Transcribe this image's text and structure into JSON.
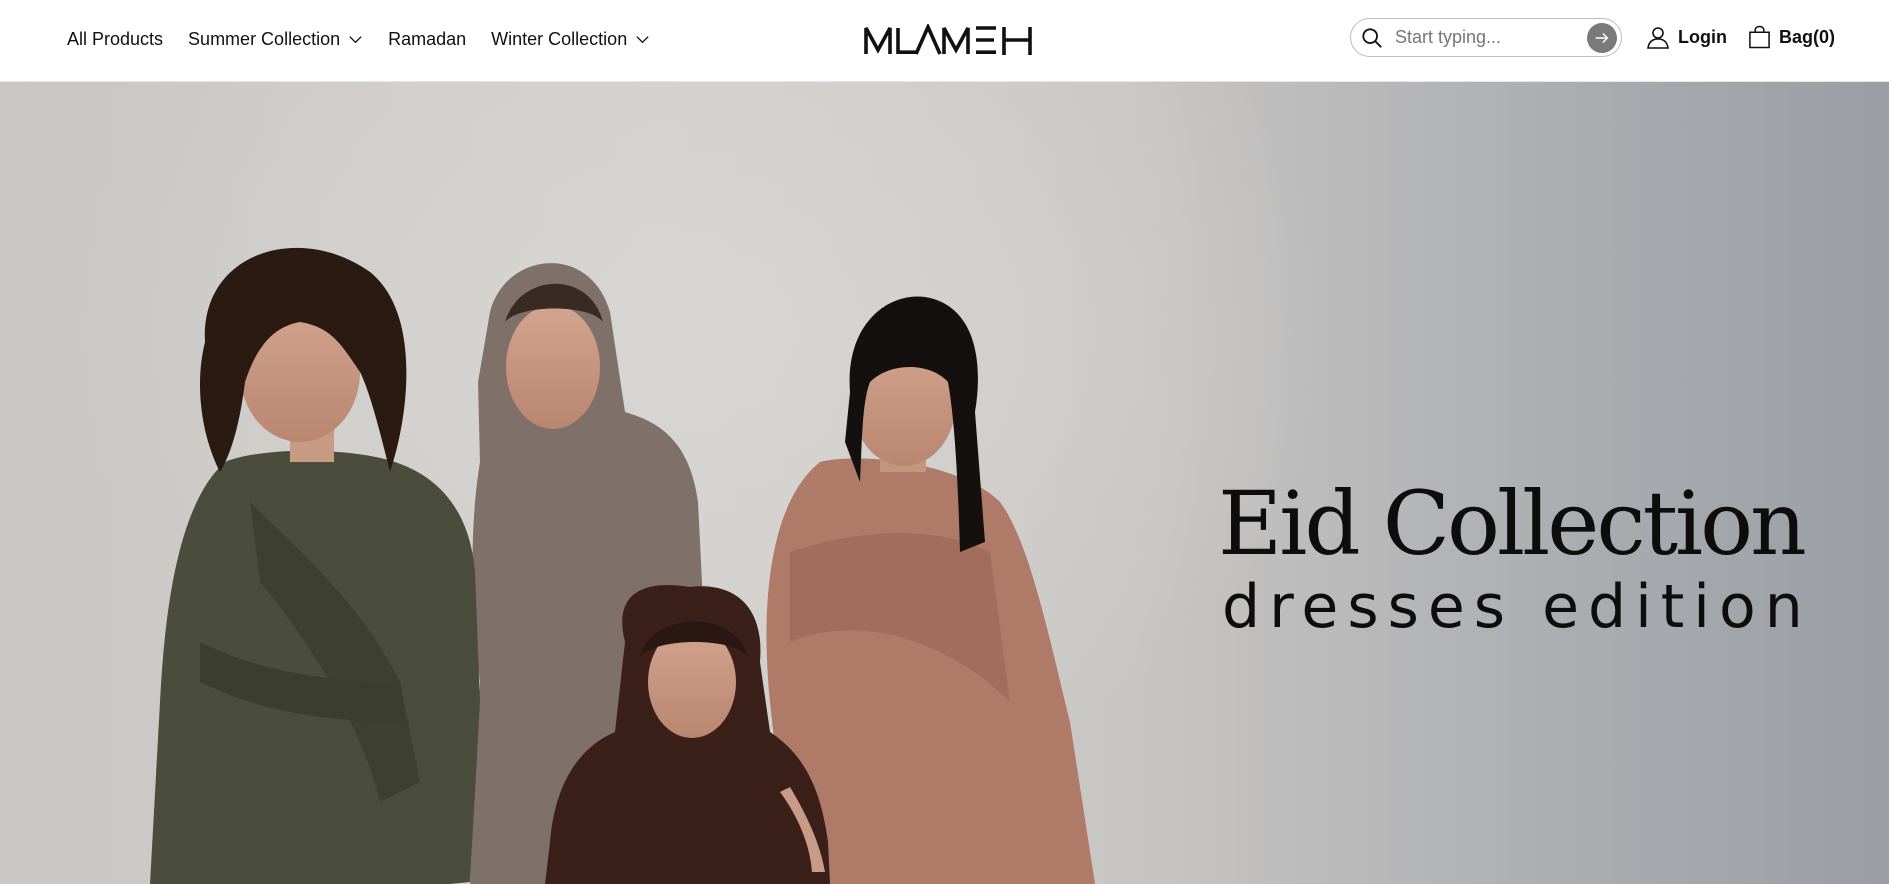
{
  "nav": {
    "items": [
      {
        "label": "All Products",
        "has_dropdown": false
      },
      {
        "label": "Summer Collection",
        "has_dropdown": true
      },
      {
        "label": "Ramadan",
        "has_dropdown": false
      },
      {
        "label": "Winter Collection",
        "has_dropdown": true
      }
    ]
  },
  "brand": {
    "logo_text": "MLAMEH"
  },
  "search": {
    "placeholder": "Start typing...",
    "value": "",
    "icon": "search-icon",
    "submit_icon": "arrow-right-icon"
  },
  "account": {
    "login_label": "Login",
    "icon": "user-icon"
  },
  "bag": {
    "label": "Bag",
    "count": "(0)",
    "icon": "shopping-bag-icon"
  },
  "hero": {
    "title": "Eid Collection",
    "subtitle": "dresses edition",
    "dress_colors": {
      "olive": "#4a4d3b",
      "taupe": "#7f706a",
      "chocolate": "#3a2019",
      "terracotta": "#b07a68"
    }
  },
  "colors": {
    "text": "#111111",
    "search_button": "#7a7a7a",
    "border": "#bdbdbd"
  }
}
